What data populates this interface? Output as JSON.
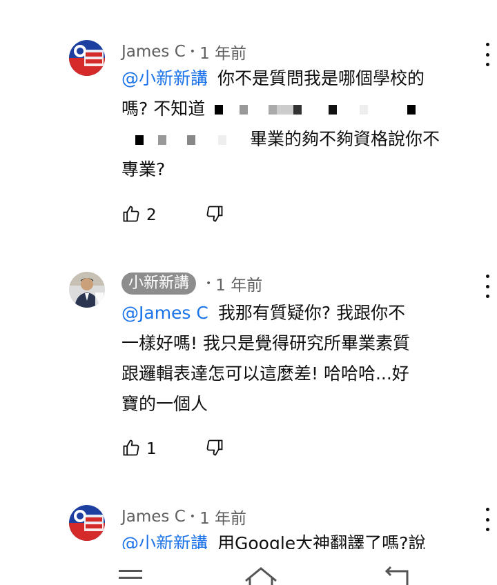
{
  "comments": [
    {
      "author": "James C",
      "time": "1 年前",
      "mention": "@小新新講",
      "line1": "你不是質問我是哪個學校的",
      "line2": "嗎? 不知道",
      "line3": "畢業的夠不夠資格說你不",
      "line4": "專業?",
      "likes": "2"
    },
    {
      "author": "小新新講",
      "time": "1 年前",
      "mention": "@James C",
      "line1": "我那有質疑你? 我跟你不",
      "line2": "一樣好嗎! 我只是覺得研究所畢業素質",
      "line3": "跟邏輯表達怎可以這麼差! 哈哈哈...好",
      "line4": "寶的一個人",
      "likes": "1"
    },
    {
      "author": "James C",
      "time": "1 年前",
      "mention": "@小新新講",
      "line1": "用Google大神翻譯了嗎?說"
    }
  ],
  "nav": {
    "menu_icon": "menu-icon",
    "home_icon": "home-icon",
    "back_icon": "back-icon"
  },
  "colors": {
    "mention": "#1a73e8",
    "meta": "#606060",
    "chip": "#8d8d8d"
  }
}
